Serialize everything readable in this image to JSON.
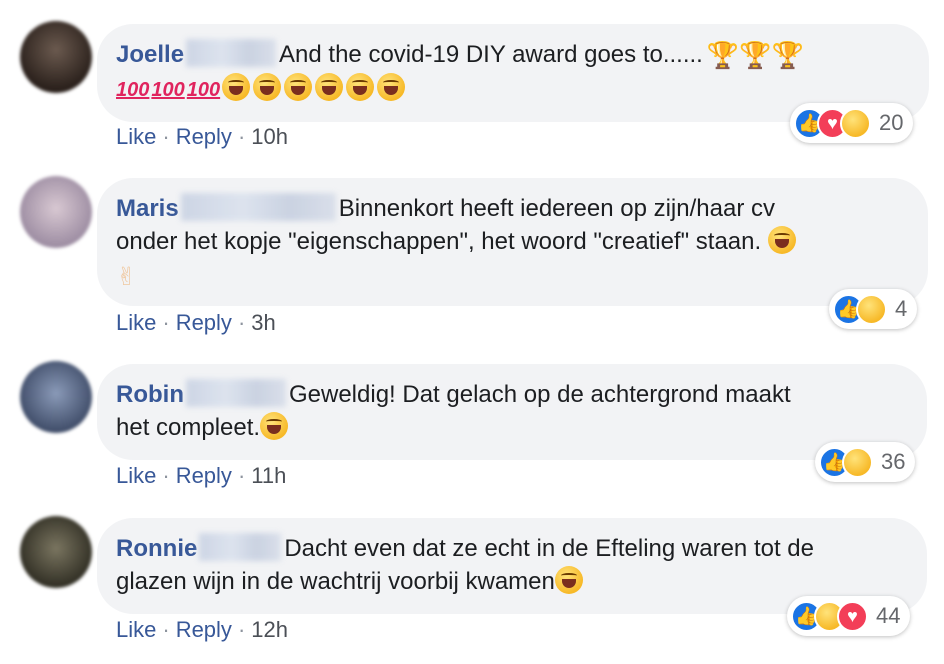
{
  "comments": [
    {
      "author": "Joelle",
      "text": "And the covid-19 DIY award goes to......",
      "emoji_line": "💯💯💯🤣🤣🤣🤣🤣🤣",
      "trophies": "🏆🏆🏆",
      "like_label": "Like",
      "reply_label": "Reply",
      "time": "10h",
      "reaction_icons": [
        "like-icon",
        "love-icon",
        "haha-icon"
      ],
      "reaction_count": "20",
      "avatar_color": "#3b2f2a"
    },
    {
      "author": "Maris",
      "text_line1": "Binnenkort heeft iedereen op zijn/haar cv",
      "text_line2": "onder het kopje \"eigenschappen\", het woord \"creatief\" staan.",
      "like_label": "Like",
      "reply_label": "Reply",
      "time": "3h",
      "reaction_icons": [
        "like-icon",
        "haha-icon"
      ],
      "reaction_count": "4",
      "avatar_color": "#b7a7b8"
    },
    {
      "author": "Robin",
      "text_line1": "Geweldig! Dat gelach op de achtergrond maakt",
      "text_line2": "het compleet.",
      "like_label": "Like",
      "reply_label": "Reply",
      "time": "11h",
      "reaction_icons": [
        "like-icon",
        "haha-icon"
      ],
      "reaction_count": "36",
      "avatar_color": "#5d6f8f"
    },
    {
      "author": "Ronnie",
      "text_line1": "Dacht even dat ze echt in de Efteling waren tot de",
      "text_line2": "glazen wijn in de wachtrij voorbij kwamen",
      "like_label": "Like",
      "reply_label": "Reply",
      "time": "12h",
      "reaction_icons": [
        "like-icon",
        "haha-icon",
        "love-icon"
      ],
      "reaction_count": "44",
      "avatar_color": "#4e4a3c"
    }
  ],
  "colors": {
    "link": "#385898",
    "bubble": "#f2f3f5",
    "text": "#1c1e21",
    "like": "#1b74e4",
    "love": "#f33e58",
    "haha": "#f7b928"
  }
}
